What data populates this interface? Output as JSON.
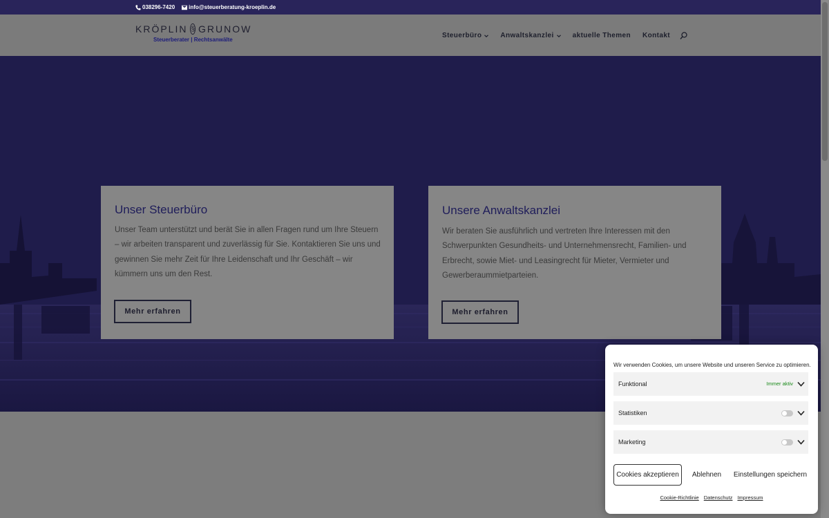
{
  "topbar": {
    "phone": "038296-7420",
    "email": "info@steuerberatung-kroeplin.de"
  },
  "logo": {
    "left_name": "KRÖPLIN",
    "symbol": "§",
    "right_name": "GRUNOW",
    "tagline": "Steuerberater | Rechtsanwälte"
  },
  "nav": {
    "items": [
      "Steuerbüro",
      "Anwaltskanzlei",
      "aktuelle Themen",
      "Kontakt"
    ]
  },
  "cards": [
    {
      "title": "Unser Steuerbüro",
      "text": "Unser Team unterstützt und berät Sie in allen Fragen rund um Ihre Steuern – wir arbeiten transparent und zuverlässig für Sie. Kontaktieren Sie uns und gewinnen Sie mehr Zeit für Ihre Leidenschaft und Ihr Geschäft – wir kümmern uns um den Rest.",
      "button": "Mehr erfahren"
    },
    {
      "title": "Unsere Anwaltskanzlei",
      "text": "Wir beraten Sie ausführlich und vertreten Ihre Interessen mit den Schwerpunkten Gesundheits- und Unternehmensrecht, Familien- und Erbrecht, sowie Miet- und Leasingrecht für Mieter, Vermieter und Gewerberaummietparteien.",
      "button": "Mehr erfahren"
    }
  ],
  "cookie": {
    "message": "Wir verwenden Cookies, um unsere Website und unseren Service zu optimieren.",
    "categories": [
      {
        "label": "Funktional",
        "status": "Immer aktiv"
      },
      {
        "label": "Statistiken",
        "status": ""
      },
      {
        "label": "Marketing",
        "status": ""
      }
    ],
    "accept": "Cookies akzeptieren",
    "decline": "Ablehnen",
    "save": "Einstellungen speichern",
    "links": [
      "Cookie-Richtlinie",
      "Datenschutz",
      "Impressum"
    ],
    "status_color": "#1a8a1a"
  },
  "colors": {
    "topbar": "#29245a",
    "hero": "#211d4d",
    "card_title": "#1f1d5a",
    "overlay": "#7d7d7d"
  },
  "icons": {
    "phone": "phone-icon",
    "email": "envelope-icon",
    "search": "search-icon",
    "dropdown": "chevron-down-icon"
  }
}
